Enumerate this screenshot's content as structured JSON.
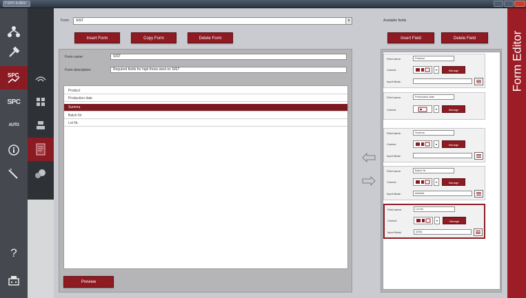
{
  "window": {
    "title": "Form Editor",
    "side_tab": "Form Editor"
  },
  "colors": {
    "accent": "#8e1a22",
    "rail": "#45494f",
    "rail_dark": "#2e3237",
    "panel": "#b5b5b8"
  },
  "sidebar": {
    "primary": [
      {
        "icon": "network-icon"
      },
      {
        "icon": "tools-icon"
      },
      {
        "icon": "spc-chart-icon",
        "active": true
      },
      {
        "label": "SPC"
      },
      {
        "label": "AUTO"
      },
      {
        "icon": "info-icon"
      },
      {
        "icon": "wand-icon"
      }
    ],
    "secondary": [
      {
        "icon": "signal-icon"
      },
      {
        "icon": "grid-cross-icon"
      },
      {
        "icon": "move-icon"
      },
      {
        "icon": "form-document-icon",
        "active": true
      },
      {
        "icon": "cloud-gear-icon"
      }
    ],
    "bottom": [
      {
        "label": "?"
      },
      {
        "icon": "printer-robot-icon"
      }
    ]
  },
  "form": {
    "label": "Form:",
    "value": "SIST",
    "buttons": {
      "insert": "Insert Form",
      "copy": "Copy Form",
      "delete": "Delete Form"
    },
    "name_label": "Form name:",
    "name_value": "SIST",
    "description_label": "Form description:",
    "description_value": "Required fields for high throw steel on SIST",
    "fields": [
      "Product",
      "Production date",
      "Summa",
      "Batch Nr",
      "Lot Nr."
    ],
    "selected_field_index": 2,
    "preview": "Preview"
  },
  "available": {
    "label": "Available fields",
    "buttons": {
      "insert": "Insert Field",
      "delete": "Delete Field"
    },
    "cards": [
      {
        "name_label": "Field name:",
        "name": "Product",
        "control_label": "Control:",
        "input_label": "Input Mask:",
        "input": "",
        "manage": "Manage",
        "has_input": true
      },
      {
        "name_label": "Field name:",
        "name": "Production date",
        "control_label": "Control:",
        "manage": "Manage",
        "has_input": false
      },
      {
        "name_label": "Field name:",
        "name": "Summa",
        "control_label": "Control:",
        "input_label": "Input Mask:",
        "input": "",
        "manage": "Manage",
        "has_input": true
      },
      {
        "name_label": "Field name:",
        "name": "Batch Nr",
        "control_label": "Control:",
        "input_label": "Input Mask:",
        "input": "######",
        "manage": "Manage",
        "has_input": true
      },
      {
        "name_label": "Field name:",
        "name": "Lot Nr.",
        "control_label": "Control:",
        "input_label": "Input Mask:",
        "input": "(000)",
        "manage": "Manage",
        "has_input": true,
        "highlight": true
      }
    ]
  }
}
